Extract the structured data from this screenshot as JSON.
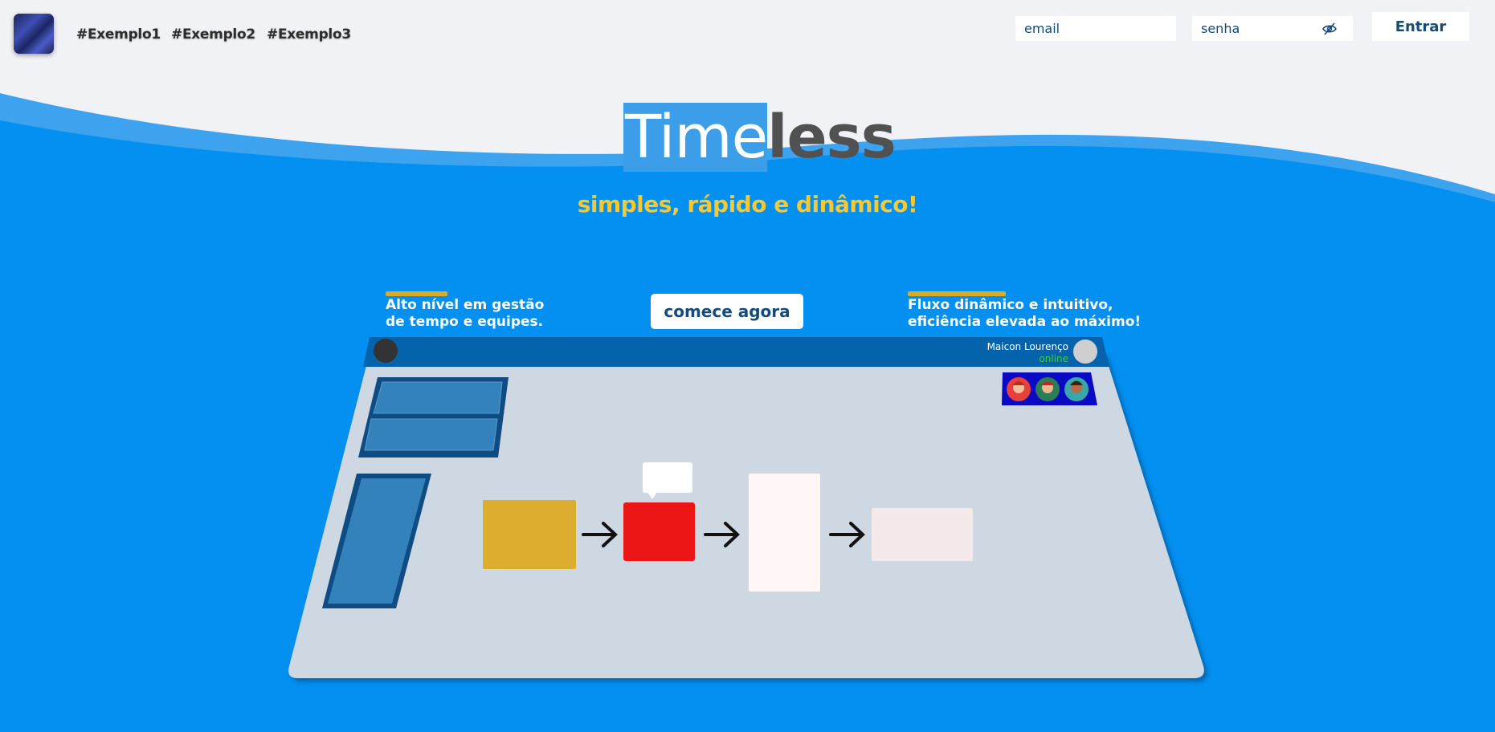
{
  "header": {
    "logo_icon": "abstract-blue-logo",
    "nav": [
      {
        "label": "#Exemplo1"
      },
      {
        "label": "#Exemplo2"
      },
      {
        "label": "#Exemplo3"
      }
    ],
    "email": {
      "placeholder": "email"
    },
    "password": {
      "placeholder": "senha",
      "toggle_icon": "eye-slash-icon"
    },
    "login_label": "Entrar"
  },
  "hero": {
    "title_selected": "Time",
    "title_rest": "less",
    "subtitle": "simples, rápido e dinâmico!",
    "left_caption": "Alto nível em gestão\nde tempo e equipes.",
    "right_caption": "Fluxo dinâmico e intuitivo,\neficiência elevada ao máximo!",
    "cta_label": "comece agora"
  },
  "board": {
    "user_name": "Maicon Lourenço",
    "user_status": "online",
    "colors": {
      "wave": "#0390f0",
      "accent": "#d9ab26",
      "topbar": "#0563ab",
      "board": "#cdd8e3",
      "yellow_card": "#ddad2f",
      "red_card": "#ec1515",
      "team_bar": "#0a0ac4"
    }
  }
}
